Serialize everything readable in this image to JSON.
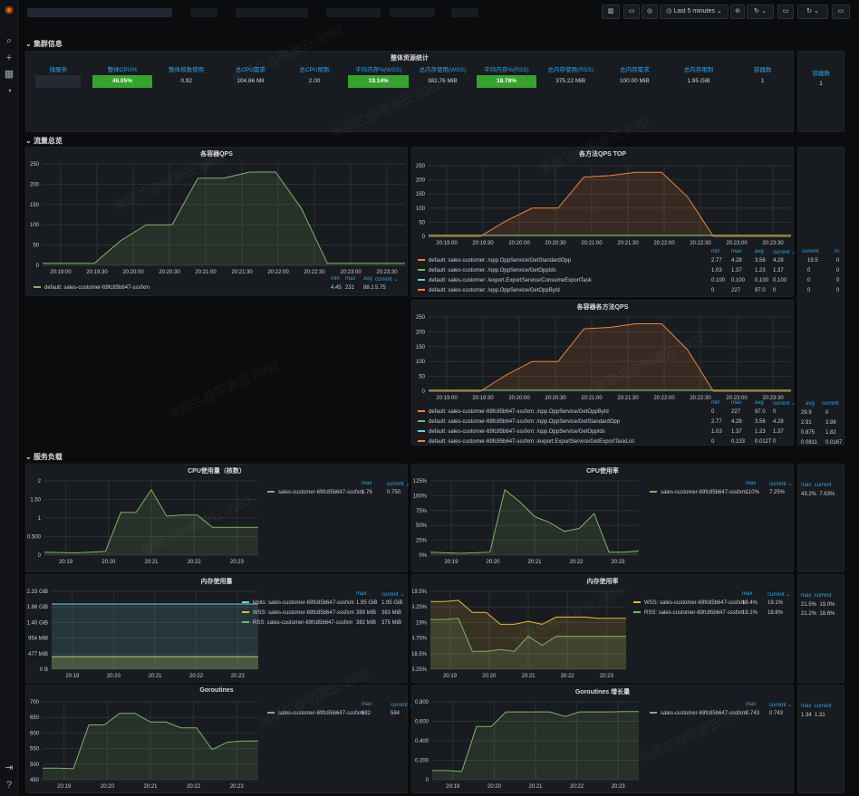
{
  "topbar": {
    "time_range": "Last 5 minutes"
  },
  "rows": {
    "cluster": "集群信息",
    "traffic": "流量总览",
    "load": "服务负载"
  },
  "overall": {
    "title": "整体资源统计",
    "headers": [
      "微服务",
      "整体CPU%",
      "整体核数使用",
      "总CPU需求",
      "总CPU限制",
      "平均内存%(WSS)",
      "总内存使用(WSS)",
      "平均内存%(RSS)",
      "总内存使用(RSS)",
      "总内存需求",
      "总内存限制",
      "容器数"
    ],
    "values": [
      "",
      "46.05%",
      "0.92",
      "104.86 Mil",
      "2.00",
      "19.14%",
      "382.76 MiB",
      "18.78%",
      "375.22 MiB",
      "100.00 MiB",
      "1.95 GiB",
      "1"
    ]
  },
  "container_count": {
    "header": "容器数",
    "value": "1"
  },
  "qps": {
    "title": "各容器QPS",
    "y_ticks": [
      "250",
      "200",
      "150",
      "100",
      "50",
      "0"
    ],
    "x_ticks": [
      "20:19:00",
      "20:19:30",
      "20:20:00",
      "20:20:30",
      "20:21:00",
      "20:21:30",
      "20:22:00",
      "20:22:30",
      "20:23:00",
      "20:23:30"
    ],
    "legend_headers": [
      "min",
      "max",
      "avg",
      "current"
    ],
    "legend_rows": [
      {
        "name": "default: sales-customer-69fc85b647-sssfxm",
        "vals": [
          "4.45",
          "231",
          "88.1",
          "5.75"
        ]
      }
    ]
  },
  "method_top": {
    "title": "各方法QPS TOP",
    "y_ticks": [
      "250",
      "200",
      "150",
      "100",
      "50",
      "0"
    ],
    "x_ticks": [
      "20:19:00",
      "20:19:30",
      "20:20:00",
      "20:20:30",
      "20:21:00",
      "20:21:30",
      "20:22:00",
      "20:22:30",
      "20:23:00",
      "20:23:30"
    ],
    "legend_headers": [
      "min",
      "max",
      "avg",
      "current"
    ],
    "legend_rows": [
      {
        "name": "default: sales-customer: /opp.OppService/GetStandardOpp",
        "vals": [
          "2.77",
          "4.28",
          "3.56",
          "4.28"
        ]
      },
      {
        "name": "default: sales-customer: /opp.OppService/GetOppIds",
        "vals": [
          "1.03",
          "1.37",
          "1.23",
          "1.37"
        ]
      },
      {
        "name": "default: sales-customer: /export.ExportService/ConsumeExportTask",
        "vals": [
          "0.100",
          "0.100",
          "0.100",
          "0.100"
        ]
      },
      {
        "name": "default: sales-customer: /opp.OppService/GetOppById",
        "vals": [
          "0",
          "227",
          "97.0",
          "0"
        ]
      }
    ]
  },
  "container_method": {
    "title": "各容器各方法QPS",
    "y_ticks": [
      "250",
      "200",
      "150",
      "100",
      "50",
      "0"
    ],
    "x_ticks": [
      "20:19:00",
      "20:19:30",
      "20:20:00",
      "20:20:30",
      "20:21:00",
      "20:21:30",
      "20:22:00",
      "20:22:30",
      "20:23:00",
      "20:23:30"
    ],
    "legend_headers": [
      "min",
      "max",
      "avg",
      "current"
    ],
    "legend_rows": [
      {
        "name": "default: sales-customer-69fc85b647-sssfxm: /opp.OppService/GetOppById",
        "vals": [
          "0",
          "227",
          "97.0",
          "0"
        ]
      },
      {
        "name": "default: sales-customer-69fc85b647-sssfxm: /opp.OppService/GetStandardOpp",
        "vals": [
          "2.77",
          "4.28",
          "3.56",
          "4.28"
        ]
      },
      {
        "name": "default: sales-customer-69fc85b647-sssfxm: /opp.OppService/GetOppIds",
        "vals": [
          "1.03",
          "1.37",
          "1.23",
          "1.37"
        ]
      },
      {
        "name": "default: sales-customer-69fc85b647-sssfxm: /export.ExportService/GetExportTaskList",
        "vals": [
          "0",
          "0.133",
          "0.0127",
          "0"
        ]
      }
    ]
  },
  "side_slivers": {
    "top_head": [
      "current",
      "m"
    ],
    "top_rows": [
      [
        "19.5",
        "0"
      ],
      [
        "0",
        "0"
      ],
      [
        "0",
        "0"
      ],
      [
        "0",
        "0"
      ]
    ],
    "mid_head": [
      "avg",
      "current"
    ],
    "mid_rows": [
      [
        "29.9",
        "0"
      ],
      [
        "2.91",
        "3.98"
      ],
      [
        "0.875",
        "1.82"
      ],
      [
        "0.0811",
        "0.0167"
      ]
    ],
    "cpu": [
      "43.2%",
      "7.63%"
    ],
    "mem": [
      [
        "21.5%",
        "19.0%"
      ],
      [
        "21.2%",
        "18.6%"
      ]
    ],
    "gor": [
      "1.34",
      "1.31"
    ]
  },
  "cpu_usage": {
    "title": "CPU使用量（核数）",
    "y_ticks": [
      "2",
      "1.50",
      "1",
      "0.500",
      "0"
    ],
    "x_ticks": [
      "20:19",
      "20:20",
      "20:21",
      "20:22",
      "20:23"
    ],
    "legend_headers": [
      "max",
      "current"
    ],
    "legend_rows": [
      {
        "name": "sales-customer-69fc85b647-sssfxm",
        "vals": [
          "1.76",
          "0.750"
        ]
      }
    ]
  },
  "cpu_rate": {
    "title": "CPU使用率",
    "y_ticks": [
      "125%",
      "100%",
      "75%",
      "50%",
      "25%",
      "0%"
    ],
    "x_ticks": [
      "20:19",
      "20:20",
      "20:21",
      "20:22",
      "20:23"
    ],
    "legend_headers": [
      "max",
      "current"
    ],
    "legend_rows": [
      {
        "name": "sales-customer-69fc85b647-sssfxm",
        "vals": [
          "110%",
          "7.25%"
        ]
      }
    ]
  },
  "mem_usage": {
    "title": "内存使用量",
    "y_ticks": [
      "2.33 GiB",
      "1.86 GiB",
      "1.40 GiB",
      "954 MiB",
      "477 MiB",
      "0 B"
    ],
    "x_ticks": [
      "20:19",
      "20:20",
      "20:21",
      "20:22",
      "20:23"
    ],
    "legend_headers": [
      "max",
      "current"
    ],
    "legend_rows": [
      {
        "name": "limits: sales-customer-69fc85b647-sssfxm",
        "vals": [
          "1.95 GiB",
          "1.95 GiB"
        ]
      },
      {
        "name": "WSS: sales-customer-69fc85b647-sssfxm",
        "vals": [
          "389 MiB",
          "383 MiB"
        ]
      },
      {
        "name": "RSS: sales-customer-69fc85b647-sssfxm",
        "vals": [
          "382 MiB",
          "375 MiB"
        ]
      }
    ]
  },
  "mem_rate": {
    "title": "内存使用率",
    "y_ticks": [
      "19.5%",
      "19.25%",
      "19%",
      "18.75%",
      "18.5%",
      "18.25%"
    ],
    "x_ticks": [
      "20:19",
      "20:20",
      "20:21",
      "20:22",
      "20:23"
    ],
    "legend_headers": [
      "max",
      "current"
    ],
    "legend_rows": [
      {
        "name": "WSS: sales-customer-69fc85b647-sssfxm",
        "vals": [
          "19.4%",
          "19.1%"
        ]
      },
      {
        "name": "RSS: sales-customer-69fc85b647-sssfxm",
        "vals": [
          "19.1%",
          "18.8%"
        ]
      }
    ]
  },
  "goroutines": {
    "title": "Goroutines",
    "y_ticks": [
      "700",
      "650",
      "600",
      "550",
      "500",
      "450"
    ],
    "x_ticks": [
      "20:19",
      "20:20",
      "20:21",
      "20:22",
      "20:23"
    ],
    "legend_headers": [
      "max",
      "current"
    ],
    "legend_rows": [
      {
        "name": "sales-customer-69fc85b647-sssfxm",
        "vals": [
          "682",
          "584"
        ]
      }
    ]
  },
  "goroutines_growth": {
    "title": "Goroutines 增长量",
    "y_ticks": [
      "0.800",
      "0.600",
      "0.400",
      "0.200",
      "0"
    ],
    "x_ticks": [
      "20:19",
      "20:20",
      "20:21",
      "20:22",
      "20:23"
    ],
    "legend_headers": [
      "max",
      "current"
    ],
    "legend_rows": [
      {
        "name": "sales-customer-69fc85b647-sssfxm",
        "vals": [
          "0.743",
          "0.743"
        ]
      }
    ]
  },
  "watermark": "张丽兰@明源云 3962",
  "chart_data": [
    {
      "type": "area",
      "panel": "qps",
      "title": "各容器QPS",
      "x": [
        "20:19:00",
        "20:19:30",
        "20:19:40",
        "20:19:50",
        "20:20:00",
        "20:20:15",
        "20:20:30",
        "20:20:45",
        "20:21:00",
        "20:21:30",
        "20:21:45",
        "20:22:00",
        "20:22:30",
        "20:23:00",
        "20:23:30"
      ],
      "series": [
        {
          "name": "default: sales-customer-69fc85b647-sssfxm",
          "color": "#7eb26d",
          "values": [
            5,
            5,
            5,
            60,
            100,
            100,
            215,
            215,
            230,
            230,
            140,
            5,
            5,
            5,
            5
          ]
        }
      ],
      "ylim": [
        0,
        250
      ]
    },
    {
      "type": "area",
      "panel": "method_top",
      "title": "各方法QPS TOP",
      "series": [
        {
          "name": "default: sales-customer: /opp.OppService/GetOppById",
          "color": "#ef843c",
          "values": [
            0,
            0,
            0,
            55,
            100,
            100,
            210,
            215,
            227,
            227,
            140,
            0,
            0,
            0,
            0
          ]
        },
        {
          "name": "default: sales-customer: /opp.OppService/GetStandardOpp",
          "color": "#7eb26d",
          "values": [
            4,
            4,
            4,
            4,
            4,
            4,
            4,
            4,
            4,
            4,
            4,
            4,
            4,
            4,
            4
          ]
        }
      ],
      "ylim": [
        0,
        250
      ]
    },
    {
      "type": "area",
      "panel": "container_method",
      "title": "各容器各方法QPS",
      "series": [
        {
          "name": "default: sales-customer-69fc85b647-sssfxm: /opp.OppService/GetOppById",
          "color": "#ef843c",
          "values": [
            0,
            0,
            0,
            55,
            100,
            100,
            210,
            215,
            227,
            227,
            140,
            0,
            0,
            0,
            0
          ]
        },
        {
          "name": "default: sales-customer-69fc85b647-sssfxm: /opp.OppService/GetStandardOpp",
          "color": "#7eb26d",
          "values": [
            4,
            4,
            4,
            4,
            4,
            4,
            4,
            4,
            4,
            4,
            4,
            4,
            4,
            4,
            4
          ]
        }
      ],
      "ylim": [
        0,
        250
      ]
    },
    {
      "type": "area",
      "panel": "cpu_usage",
      "title": "CPU使用量（核数）",
      "series": [
        {
          "name": "sales-customer-69fc85b647-sssfxm",
          "color": "#7eb26d",
          "values": [
            0.08,
            0.07,
            0.06,
            0.08,
            0.1,
            1.15,
            1.15,
            1.76,
            1.05,
            1.08,
            1.08,
            0.75,
            0.75,
            0.75,
            0.75
          ]
        }
      ],
      "ylim": [
        0,
        2
      ]
    },
    {
      "type": "area",
      "panel": "cpu_rate",
      "title": "CPU使用率",
      "series": [
        {
          "name": "sales-customer-69fc85b647-sssfxm",
          "color": "#7eb26d",
          "values": [
            5,
            4,
            3,
            4,
            5,
            110,
            90,
            65,
            55,
            40,
            45,
            70,
            5,
            5,
            7
          ]
        }
      ],
      "ylim": [
        0,
        125
      ]
    },
    {
      "type": "area",
      "panel": "mem_usage",
      "title": "内存使用量",
      "series": [
        {
          "name": "limits: sales-customer-69fc85b647-sssfxm",
          "color": "#6ed0e0",
          "values": [
            1997,
            1997,
            1997,
            1997,
            1997,
            1997,
            1997,
            1997,
            1997,
            1997,
            1997,
            1997,
            1997,
            1997,
            1997
          ]
        },
        {
          "name": "WSS: sales-customer-69fc85b647-sssfxm",
          "color": "#eab839",
          "values": [
            385,
            385,
            385,
            385,
            385,
            385,
            385,
            385,
            385,
            385,
            385,
            385,
            385,
            385,
            383
          ]
        },
        {
          "name": "RSS: sales-customer-69fc85b647-sssfxm",
          "color": "#7eb26d",
          "values": [
            378,
            378,
            378,
            378,
            378,
            378,
            378,
            378,
            378,
            378,
            378,
            378,
            378,
            378,
            375
          ]
        }
      ],
      "ylim": [
        0,
        2386
      ]
    },
    {
      "type": "area",
      "panel": "mem_rate",
      "title": "内存使用率",
      "series": [
        {
          "name": "WSS: sales-customer-69fc85b647-sssfxm",
          "color": "#eab839",
          "values": [
            19.38,
            19.38,
            19.4,
            19.2,
            19.2,
            19.0,
            19.0,
            19.05,
            19.0,
            19.12,
            19.12,
            19.12,
            19.1,
            19.1,
            19.1
          ]
        },
        {
          "name": "RSS: sales-customer-69fc85b647-sssfxm",
          "color": "#7eb26d",
          "values": [
            19.08,
            19.08,
            19.1,
            18.55,
            18.55,
            18.58,
            18.55,
            18.8,
            18.65,
            18.8,
            18.8,
            18.8,
            18.8,
            18.8,
            18.8
          ]
        }
      ],
      "ylim": [
        18.25,
        19.55
      ]
    },
    {
      "type": "area",
      "panel": "goroutines",
      "title": "Goroutines",
      "series": [
        {
          "name": "sales-customer-69fc85b647-sssfxm",
          "color": "#7eb26d",
          "values": [
            490,
            490,
            488,
            640,
            640,
            680,
            680,
            650,
            650,
            630,
            630,
            555,
            580,
            584,
            584
          ]
        }
      ],
      "ylim": [
        450,
        720
      ]
    },
    {
      "type": "area",
      "panel": "goroutines_growth",
      "title": "Goroutines 增长量",
      "series": [
        {
          "name": "sales-customer-69fc85b647-sssfxm",
          "color": "#7eb26d",
          "values": [
            0.1,
            0.1,
            0.09,
            0.58,
            0.58,
            0.74,
            0.74,
            0.74,
            0.74,
            0.69,
            0.74,
            0.74,
            0.74,
            0.743,
            0.743
          ]
        }
      ],
      "ylim": [
        0,
        0.85
      ]
    }
  ]
}
